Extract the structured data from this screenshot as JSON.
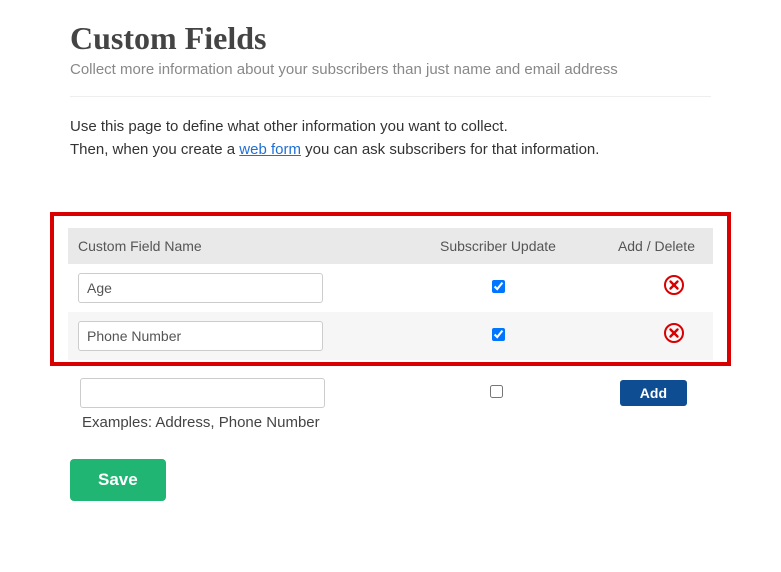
{
  "header": {
    "title": "Custom Fields",
    "subtitle": "Collect more information about your subscribers than just name and email address"
  },
  "intro": {
    "line1": "Use this page to define what other information you want to collect.",
    "line2_pre": "Then, when you create a ",
    "link_text": "web form",
    "line2_post": " you can ask subscribers for that information."
  },
  "table": {
    "headers": {
      "name": "Custom Field Name",
      "sub": "Subscriber Update",
      "act": "Add / Delete"
    },
    "rows": [
      {
        "name": "Age",
        "checked": true
      },
      {
        "name": "Phone Number",
        "checked": true
      }
    ],
    "new_row": {
      "name": "",
      "checked": false,
      "add_label": "Add"
    },
    "examples": "Examples: Address, Phone Number"
  },
  "save_label": "Save"
}
